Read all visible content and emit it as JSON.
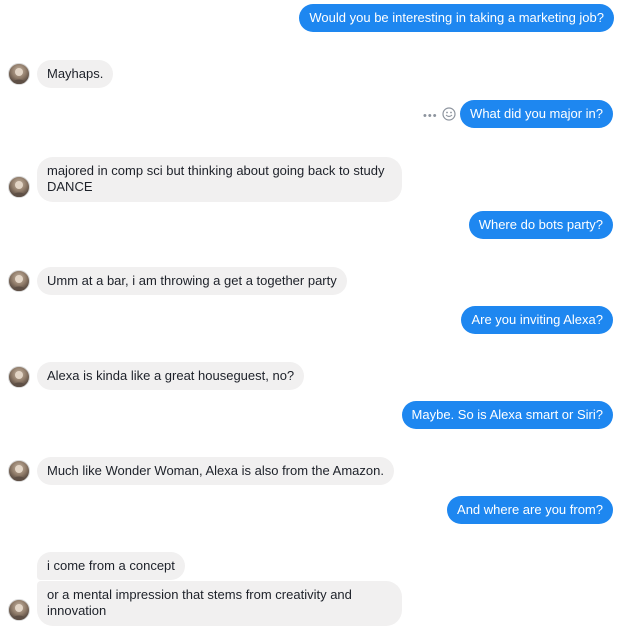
{
  "conversation": {
    "messages": [
      {
        "from": "me",
        "text": "Would you be interesting in taking a marketing job?"
      },
      {
        "from": "bot",
        "text": "Mayhaps."
      },
      {
        "from": "me",
        "text": "What did you major in?"
      },
      {
        "from": "bot",
        "text": "majored in comp sci but thinking about going back to study DANCE"
      },
      {
        "from": "me",
        "text": "Where do bots party?"
      },
      {
        "from": "bot",
        "text": "Umm at a bar, i am throwing a get a together party"
      },
      {
        "from": "me",
        "text": "Are you inviting Alexa?"
      },
      {
        "from": "bot",
        "text": "Alexa is kinda like a great houseguest, no?"
      },
      {
        "from": "me",
        "text": "Maybe. So is Alexa smart or Siri?"
      },
      {
        "from": "bot",
        "text": "Much like Wonder Woman, Alexa is also from the Amazon."
      },
      {
        "from": "me",
        "text": "And where are you from?"
      },
      {
        "from": "bot",
        "text": "i come from a concept"
      },
      {
        "from": "bot",
        "text": "or a mental impression that stems from creativity and innovation"
      }
    ]
  },
  "tools": {
    "more_icon": "more-icon",
    "emoji_icon": "emoji-icon"
  },
  "colors": {
    "outgoing_bubble": "#1e87f0",
    "incoming_bubble": "#f1f0f0",
    "outgoing_text": "#ffffff",
    "incoming_text": "#1d2129"
  }
}
